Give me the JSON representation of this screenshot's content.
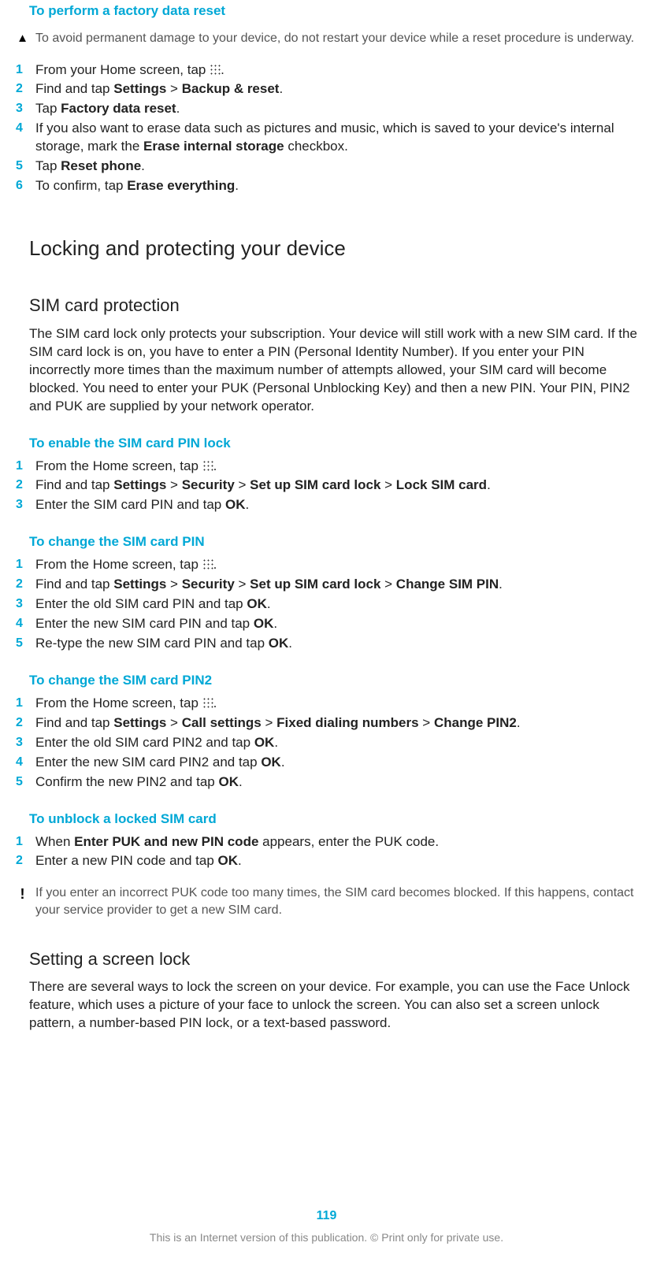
{
  "sec1": {
    "title": "To perform a factory data reset",
    "warn": "To avoid permanent damage to your device, do not restart your device while a reset procedure is underway.",
    "steps": [
      {
        "n": "1",
        "pre": "From your Home screen, tap ",
        "icon": true,
        "post": "."
      },
      {
        "n": "2",
        "parts": [
          "Find and tap ",
          "Settings",
          " > ",
          "Backup & reset",
          "."
        ]
      },
      {
        "n": "3",
        "parts": [
          "Tap ",
          "Factory data reset",
          "."
        ]
      },
      {
        "n": "4",
        "parts": [
          "If you also want to erase data such as pictures and music, which is saved to your device's internal storage, mark the ",
          "Erase internal storage",
          " checkbox."
        ]
      },
      {
        "n": "5",
        "parts": [
          "Tap ",
          "Reset phone",
          "."
        ]
      },
      {
        "n": "6",
        "parts": [
          "To confirm, tap ",
          "Erase everything",
          "."
        ]
      }
    ]
  },
  "h2": "Locking and protecting your device",
  "sim": {
    "title": "SIM card protection",
    "para": "The SIM card lock only protects your subscription. Your device will still work with a new SIM card. If the SIM card lock is on, you have to enter a PIN (Personal Identity Number). If you enter your PIN incorrectly more times than the maximum number of attempts allowed, your SIM card will become blocked. You need to enter your PUK (Personal Unblocking Key) and then a new PIN. Your PIN, PIN2 and PUK are supplied by your network operator."
  },
  "enable": {
    "title": "To enable the SIM card PIN lock",
    "steps": [
      {
        "n": "1",
        "pre": "From the Home screen, tap ",
        "icon": true,
        "post": "."
      },
      {
        "n": "2",
        "parts": [
          "Find and tap ",
          "Settings",
          " > ",
          "Security",
          " > ",
          "Set up SIM card lock",
          " > ",
          "Lock SIM card",
          "."
        ]
      },
      {
        "n": "3",
        "parts": [
          "Enter the SIM card PIN and tap ",
          "OK",
          "."
        ]
      }
    ]
  },
  "changepin": {
    "title": "To change the SIM card PIN",
    "steps": [
      {
        "n": "1",
        "pre": "From the Home screen, tap ",
        "icon": true,
        "post": "."
      },
      {
        "n": "2",
        "parts": [
          "Find and tap ",
          "Settings",
          " > ",
          "Security",
          " > ",
          "Set up SIM card lock",
          " > ",
          "Change SIM PIN",
          "."
        ]
      },
      {
        "n": "3",
        "parts": [
          "Enter the old SIM card PIN and tap ",
          "OK",
          "."
        ]
      },
      {
        "n": "4",
        "parts": [
          "Enter the new SIM card PIN and tap ",
          "OK",
          "."
        ]
      },
      {
        "n": "5",
        "parts": [
          "Re-type the new SIM card PIN and tap ",
          "OK",
          "."
        ]
      }
    ]
  },
  "changepin2": {
    "title": "To change the SIM card PIN2",
    "steps": [
      {
        "n": "1",
        "pre": "From the Home screen, tap ",
        "icon": true,
        "post": "."
      },
      {
        "n": "2",
        "parts": [
          "Find and tap ",
          "Settings",
          " > ",
          "Call settings",
          " > ",
          "Fixed dialing numbers",
          " > ",
          "Change PIN2",
          "."
        ]
      },
      {
        "n": "3",
        "parts": [
          "Enter the old SIM card PIN2 and tap ",
          "OK",
          "."
        ]
      },
      {
        "n": "4",
        "parts": [
          "Enter the new SIM card PIN2 and tap ",
          "OK",
          "."
        ]
      },
      {
        "n": "5",
        "parts": [
          "Confirm the new PIN2 and tap ",
          "OK",
          "."
        ]
      }
    ]
  },
  "unblock": {
    "title": "To unblock a locked SIM card",
    "steps": [
      {
        "n": "1",
        "parts": [
          "When ",
          "Enter PUK and new PIN code",
          " appears, enter the PUK code."
        ]
      },
      {
        "n": "2",
        "parts": [
          "Enter a new PIN code and tap ",
          "OK",
          "."
        ]
      }
    ],
    "note": "If you enter an incorrect PUK code too many times, the SIM card becomes blocked. If this happens, contact your service provider to get a new SIM card."
  },
  "screenlock": {
    "title": "Setting a screen lock",
    "para": "There are several ways to lock the screen on your device. For example, you can use the Face Unlock feature, which uses a picture of your face to unlock the screen. You can also set a screen unlock pattern, a number-based PIN lock, or a text-based password."
  },
  "page": "119",
  "footer": "This is an Internet version of this publication. © Print only for private use."
}
